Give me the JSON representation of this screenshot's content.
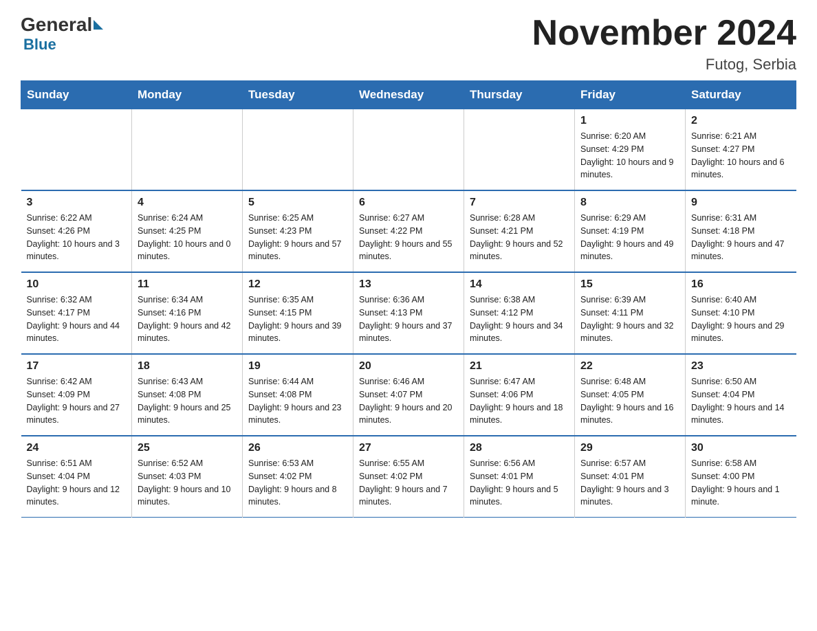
{
  "header": {
    "logo_general": "General",
    "logo_blue": "Blue",
    "month_title": "November 2024",
    "location": "Futog, Serbia"
  },
  "weekdays": [
    "Sunday",
    "Monday",
    "Tuesday",
    "Wednesday",
    "Thursday",
    "Friday",
    "Saturday"
  ],
  "weeks": [
    [
      {
        "day": "",
        "sunrise": "",
        "sunset": "",
        "daylight": ""
      },
      {
        "day": "",
        "sunrise": "",
        "sunset": "",
        "daylight": ""
      },
      {
        "day": "",
        "sunrise": "",
        "sunset": "",
        "daylight": ""
      },
      {
        "day": "",
        "sunrise": "",
        "sunset": "",
        "daylight": ""
      },
      {
        "day": "",
        "sunrise": "",
        "sunset": "",
        "daylight": ""
      },
      {
        "day": "1",
        "sunrise": "Sunrise: 6:20 AM",
        "sunset": "Sunset: 4:29 PM",
        "daylight": "Daylight: 10 hours and 9 minutes."
      },
      {
        "day": "2",
        "sunrise": "Sunrise: 6:21 AM",
        "sunset": "Sunset: 4:27 PM",
        "daylight": "Daylight: 10 hours and 6 minutes."
      }
    ],
    [
      {
        "day": "3",
        "sunrise": "Sunrise: 6:22 AM",
        "sunset": "Sunset: 4:26 PM",
        "daylight": "Daylight: 10 hours and 3 minutes."
      },
      {
        "day": "4",
        "sunrise": "Sunrise: 6:24 AM",
        "sunset": "Sunset: 4:25 PM",
        "daylight": "Daylight: 10 hours and 0 minutes."
      },
      {
        "day": "5",
        "sunrise": "Sunrise: 6:25 AM",
        "sunset": "Sunset: 4:23 PM",
        "daylight": "Daylight: 9 hours and 57 minutes."
      },
      {
        "day": "6",
        "sunrise": "Sunrise: 6:27 AM",
        "sunset": "Sunset: 4:22 PM",
        "daylight": "Daylight: 9 hours and 55 minutes."
      },
      {
        "day": "7",
        "sunrise": "Sunrise: 6:28 AM",
        "sunset": "Sunset: 4:21 PM",
        "daylight": "Daylight: 9 hours and 52 minutes."
      },
      {
        "day": "8",
        "sunrise": "Sunrise: 6:29 AM",
        "sunset": "Sunset: 4:19 PM",
        "daylight": "Daylight: 9 hours and 49 minutes."
      },
      {
        "day": "9",
        "sunrise": "Sunrise: 6:31 AM",
        "sunset": "Sunset: 4:18 PM",
        "daylight": "Daylight: 9 hours and 47 minutes."
      }
    ],
    [
      {
        "day": "10",
        "sunrise": "Sunrise: 6:32 AM",
        "sunset": "Sunset: 4:17 PM",
        "daylight": "Daylight: 9 hours and 44 minutes."
      },
      {
        "day": "11",
        "sunrise": "Sunrise: 6:34 AM",
        "sunset": "Sunset: 4:16 PM",
        "daylight": "Daylight: 9 hours and 42 minutes."
      },
      {
        "day": "12",
        "sunrise": "Sunrise: 6:35 AM",
        "sunset": "Sunset: 4:15 PM",
        "daylight": "Daylight: 9 hours and 39 minutes."
      },
      {
        "day": "13",
        "sunrise": "Sunrise: 6:36 AM",
        "sunset": "Sunset: 4:13 PM",
        "daylight": "Daylight: 9 hours and 37 minutes."
      },
      {
        "day": "14",
        "sunrise": "Sunrise: 6:38 AM",
        "sunset": "Sunset: 4:12 PM",
        "daylight": "Daylight: 9 hours and 34 minutes."
      },
      {
        "day": "15",
        "sunrise": "Sunrise: 6:39 AM",
        "sunset": "Sunset: 4:11 PM",
        "daylight": "Daylight: 9 hours and 32 minutes."
      },
      {
        "day": "16",
        "sunrise": "Sunrise: 6:40 AM",
        "sunset": "Sunset: 4:10 PM",
        "daylight": "Daylight: 9 hours and 29 minutes."
      }
    ],
    [
      {
        "day": "17",
        "sunrise": "Sunrise: 6:42 AM",
        "sunset": "Sunset: 4:09 PM",
        "daylight": "Daylight: 9 hours and 27 minutes."
      },
      {
        "day": "18",
        "sunrise": "Sunrise: 6:43 AM",
        "sunset": "Sunset: 4:08 PM",
        "daylight": "Daylight: 9 hours and 25 minutes."
      },
      {
        "day": "19",
        "sunrise": "Sunrise: 6:44 AM",
        "sunset": "Sunset: 4:08 PM",
        "daylight": "Daylight: 9 hours and 23 minutes."
      },
      {
        "day": "20",
        "sunrise": "Sunrise: 6:46 AM",
        "sunset": "Sunset: 4:07 PM",
        "daylight": "Daylight: 9 hours and 20 minutes."
      },
      {
        "day": "21",
        "sunrise": "Sunrise: 6:47 AM",
        "sunset": "Sunset: 4:06 PM",
        "daylight": "Daylight: 9 hours and 18 minutes."
      },
      {
        "day": "22",
        "sunrise": "Sunrise: 6:48 AM",
        "sunset": "Sunset: 4:05 PM",
        "daylight": "Daylight: 9 hours and 16 minutes."
      },
      {
        "day": "23",
        "sunrise": "Sunrise: 6:50 AM",
        "sunset": "Sunset: 4:04 PM",
        "daylight": "Daylight: 9 hours and 14 minutes."
      }
    ],
    [
      {
        "day": "24",
        "sunrise": "Sunrise: 6:51 AM",
        "sunset": "Sunset: 4:04 PM",
        "daylight": "Daylight: 9 hours and 12 minutes."
      },
      {
        "day": "25",
        "sunrise": "Sunrise: 6:52 AM",
        "sunset": "Sunset: 4:03 PM",
        "daylight": "Daylight: 9 hours and 10 minutes."
      },
      {
        "day": "26",
        "sunrise": "Sunrise: 6:53 AM",
        "sunset": "Sunset: 4:02 PM",
        "daylight": "Daylight: 9 hours and 8 minutes."
      },
      {
        "day": "27",
        "sunrise": "Sunrise: 6:55 AM",
        "sunset": "Sunset: 4:02 PM",
        "daylight": "Daylight: 9 hours and 7 minutes."
      },
      {
        "day": "28",
        "sunrise": "Sunrise: 6:56 AM",
        "sunset": "Sunset: 4:01 PM",
        "daylight": "Daylight: 9 hours and 5 minutes."
      },
      {
        "day": "29",
        "sunrise": "Sunrise: 6:57 AM",
        "sunset": "Sunset: 4:01 PM",
        "daylight": "Daylight: 9 hours and 3 minutes."
      },
      {
        "day": "30",
        "sunrise": "Sunrise: 6:58 AM",
        "sunset": "Sunset: 4:00 PM",
        "daylight": "Daylight: 9 hours and 1 minute."
      }
    ]
  ]
}
